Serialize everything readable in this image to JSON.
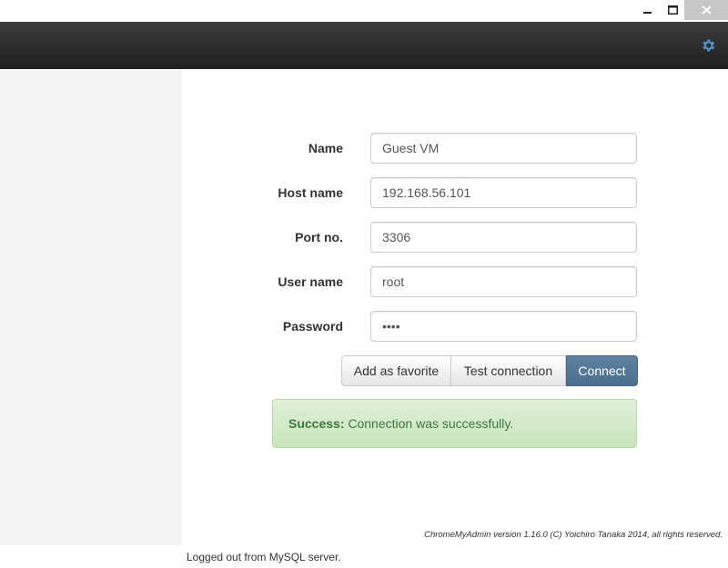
{
  "window": {
    "minimize_label": "minimize",
    "maximize_label": "maximize",
    "close_label": "close"
  },
  "header": {
    "settings_icon": "gear-icon"
  },
  "form": {
    "name": {
      "label": "Name",
      "value": "Guest VM"
    },
    "host": {
      "label": "Host name",
      "value": "192.168.56.101"
    },
    "port": {
      "label": "Port no.",
      "value": "3306"
    },
    "user": {
      "label": "User name",
      "value": "root"
    },
    "password": {
      "label": "Password",
      "value": "root"
    }
  },
  "buttons": {
    "favorite": "Add as favorite",
    "test": "Test connection",
    "connect": "Connect"
  },
  "alert": {
    "title": "Success:",
    "message": " Connection was successfully."
  },
  "footer": {
    "version": "ChromeMyAdmin version 1.16.0 (C) Yoichiro Tanaka 2014, all rights reserved."
  },
  "status": {
    "text": "Logged out from MySQL server."
  },
  "colors": {
    "accent": "#4f7594",
    "success_bg": "#dff0d8",
    "success_text": "#3c763d",
    "header_bg": "#2b2b2b"
  }
}
